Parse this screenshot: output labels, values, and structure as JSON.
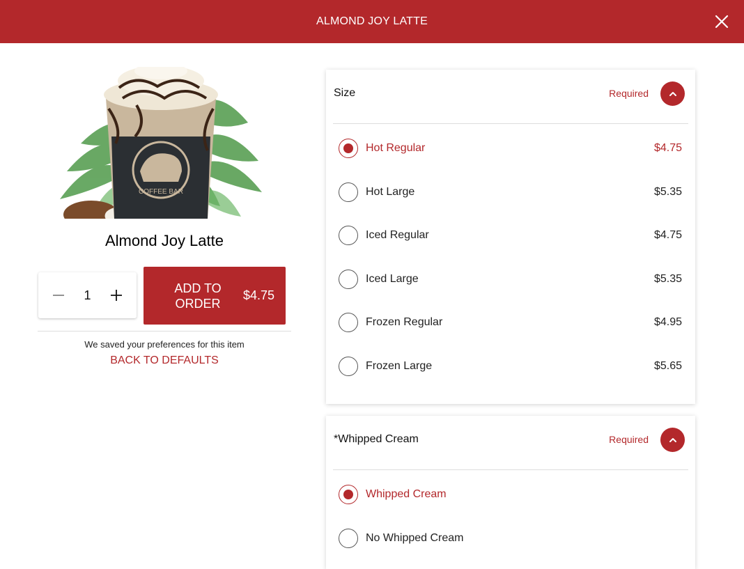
{
  "header": {
    "title": "ALMOND JOY LATTE"
  },
  "product": {
    "name": "Almond Joy Latte",
    "image_text": "COFFEE BAR",
    "quantity": "1",
    "add_to_order_label": "ADD TO ORDER",
    "price": "$4.75",
    "preferences_note": "We saved your preferences for this item",
    "back_to_defaults": "BACK TO DEFAULTS"
  },
  "size_group": {
    "title": "Size",
    "required": "Required",
    "options": [
      {
        "label": "Hot Regular",
        "price": "$4.75",
        "selected": true
      },
      {
        "label": "Hot Large",
        "price": "$5.35",
        "selected": false
      },
      {
        "label": "Iced Regular",
        "price": "$4.75",
        "selected": false
      },
      {
        "label": "Iced Large",
        "price": "$5.35",
        "selected": false
      },
      {
        "label": "Frozen Regular",
        "price": "$4.95",
        "selected": false
      },
      {
        "label": "Frozen Large",
        "price": "$5.65",
        "selected": false
      }
    ]
  },
  "whipped_group": {
    "title": "*Whipped Cream",
    "required": "Required",
    "options": [
      {
        "label": "Whipped Cream",
        "selected": true
      },
      {
        "label": "No Whipped Cream",
        "selected": false
      }
    ]
  },
  "colors": {
    "accent": "#b3282b"
  },
  "icons": {
    "close": "close-icon",
    "collapse": "chevron-up-icon",
    "minus": "minus-icon",
    "plus": "plus-icon"
  }
}
